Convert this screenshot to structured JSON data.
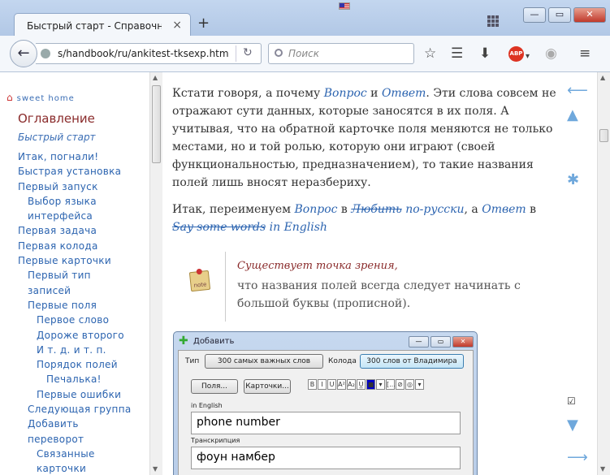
{
  "browser": {
    "tab_title": "Быстрый старт - Справочник ...",
    "tab_close": "×",
    "new_tab": "+",
    "url": "s/handbook/ru/ankitest-tksexp.htm",
    "search_placeholder": "Поиск",
    "window_buttons": {
      "minimize": "—",
      "maximize": "▭",
      "close": "✕"
    },
    "back_glyph": "←",
    "reload_glyph": "↻",
    "abp_label": "ABP",
    "toolbar_icons": [
      "star-icon",
      "reading-list-icon",
      "download-icon",
      "adblock-icon",
      "sync-icon",
      "menu-icon"
    ]
  },
  "sidebar": {
    "home_label": "sweet home",
    "toc_title": "Оглавление",
    "quick_start": "Быстрый старт",
    "items": [
      {
        "label": "Итак, погнали!",
        "level": 0
      },
      {
        "label": "Быстрая установка",
        "level": 0
      },
      {
        "label": "Первый запуск",
        "level": 0
      },
      {
        "label": "Выбор языка",
        "level": 1
      },
      {
        "label": "интерфейса",
        "level": 1
      },
      {
        "label": "Первая задача",
        "level": 0
      },
      {
        "label": "Первая колода",
        "level": 0
      },
      {
        "label": "Первые карточки",
        "level": 0
      },
      {
        "label": "Первый тип",
        "level": 1
      },
      {
        "label": "записей",
        "level": 1
      },
      {
        "label": "Первые поля",
        "level": 1
      },
      {
        "label": "Первое слово",
        "level": 2
      },
      {
        "label": "Дороже второго",
        "level": 2
      },
      {
        "label": "И т. д. и т. п.",
        "level": 2
      },
      {
        "label": "Порядок полей",
        "level": 2
      },
      {
        "label": "Печалька!",
        "level": 3
      },
      {
        "label": "Первые ошибки",
        "level": 2
      },
      {
        "label": "Следующая группа",
        "level": 1
      },
      {
        "label": "Добавить",
        "level": 1
      },
      {
        "label": "переворот",
        "level": 1
      },
      {
        "label": "Связанные",
        "level": 2
      },
      {
        "label": "карточки",
        "level": 2
      }
    ]
  },
  "article": {
    "p1": {
      "t1": "Кстати говоря, а почему ",
      "q": "Вопрос",
      "t2": " и ",
      "a": "Ответ",
      "t3": ". Эти слова совсем не отражают сути данных, которые заносятся в их поля. А учитывая, что на обратной карточке поля меняются не только местами, но и той ролью, которую они играют (своей функциональностью, предназначением), то такие названия полей лишь вносят неразбериху."
    },
    "p2": {
      "t1": "Итак, переименуем ",
      "q": "Вопрос",
      "t2": " в ",
      "s1": "Любить",
      "r1": " по-русски",
      "t3": ", а ",
      "a": "Ответ",
      "t4": " в ",
      "s2": "Say some words",
      "r2": " in English"
    },
    "note": {
      "icon_label": "note",
      "heading": "Существует точка зрения,",
      "body": "что названия полей всегда следует начинать с большой буквы (прописной)."
    }
  },
  "dialog": {
    "title": "Добавить",
    "type_label": "Тип",
    "type_value": "300 самых важных слов",
    "deck_label": "Колода",
    "deck_value": "300 слов от Владимира",
    "fields_button": "Поля...",
    "cards_button": "Карточки...",
    "format_buttons": [
      "B",
      "I",
      "U",
      "A²",
      "A₂",
      "U̲",
      "■",
      "▾",
      "[...]",
      "⊘",
      "◎",
      "▾"
    ],
    "field1_label": "in English",
    "field1_value": "phone number",
    "field2_label": "Транскрипция",
    "field2_value": "фоун намбер"
  },
  "rail": {
    "items": [
      "⟵",
      "▲",
      "✱",
      "☑",
      "▼",
      "⟶"
    ]
  },
  "colors": {
    "link": "#2c64b0",
    "toc_heading": "#8a2b2b",
    "text": "#333333"
  }
}
